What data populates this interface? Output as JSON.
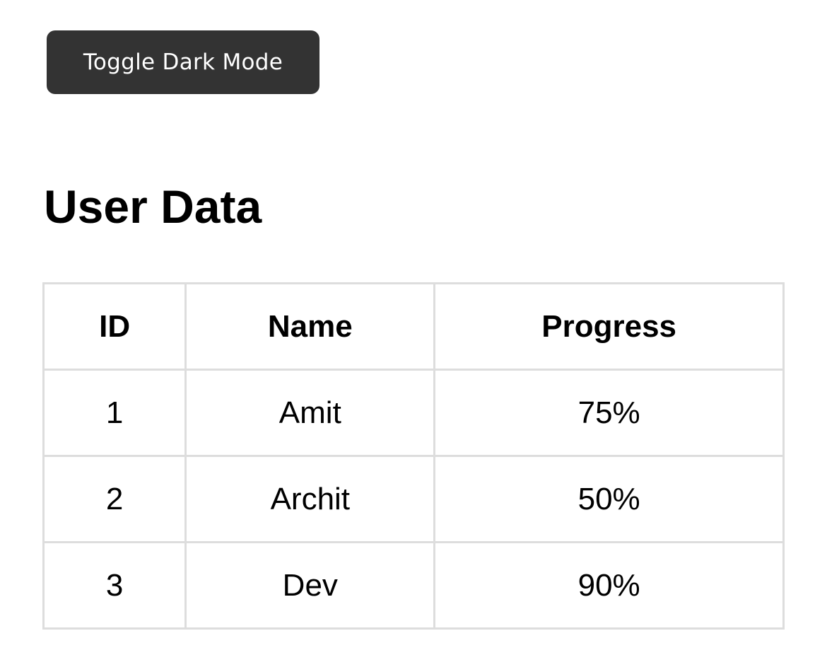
{
  "toolbar": {
    "toggle_label": "Toggle Dark Mode"
  },
  "main": {
    "title": "User Data",
    "table": {
      "headers": [
        "ID",
        "Name",
        "Progress"
      ],
      "rows": [
        [
          "1",
          "Amit",
          "75%"
        ],
        [
          "2",
          "Archit",
          "50%"
        ],
        [
          "3",
          "Dev",
          "90%"
        ]
      ]
    }
  },
  "colors": {
    "button_bg": "#333333",
    "button_text": "#ffffff",
    "table_border": "#dddddd",
    "text": "#000000",
    "background": "#ffffff"
  }
}
